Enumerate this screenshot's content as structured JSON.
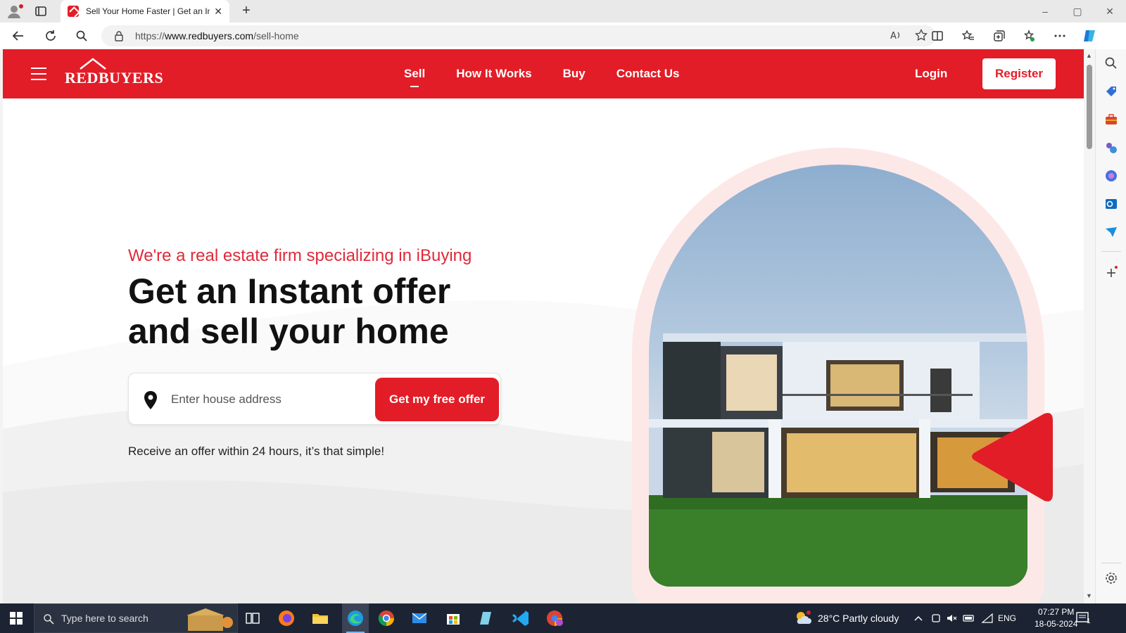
{
  "browser": {
    "tab_title": "Sell Your Home Faster | Get an In",
    "url_prefix": "https://",
    "url_domain": "www.redbuyers.com",
    "url_path": "/sell-home",
    "new_tab": "+",
    "close_tab": "✕",
    "window_controls": [
      "–",
      "▢",
      "✕"
    ]
  },
  "site": {
    "logo_text": "REDBUYERS",
    "nav_links": [
      "Sell",
      "How It Works",
      "Buy",
      "Contact Us"
    ],
    "active_link": "Sell",
    "login_label": "Login",
    "register_label": "Register"
  },
  "hero": {
    "subtitle": "We're a real estate firm specializing in iBuying",
    "title_line1": "Get an Instant offer",
    "title_line2": "and sell your home",
    "search_placeholder": "Enter house address",
    "offer_button": "Get my free offer",
    "note": "Receive an offer within 24 hours, it’s that simple!"
  },
  "taskbar": {
    "search_placeholder": "Type here to search",
    "weather": "28°C  Partly cloudy",
    "language": "ENG",
    "time": "07:27 PM",
    "date": "18-05-2024",
    "notification_count": "1"
  },
  "colors": {
    "brand_red": "#e21d27",
    "subtitle_red": "#e0293a",
    "taskbar": "#1c2433"
  }
}
